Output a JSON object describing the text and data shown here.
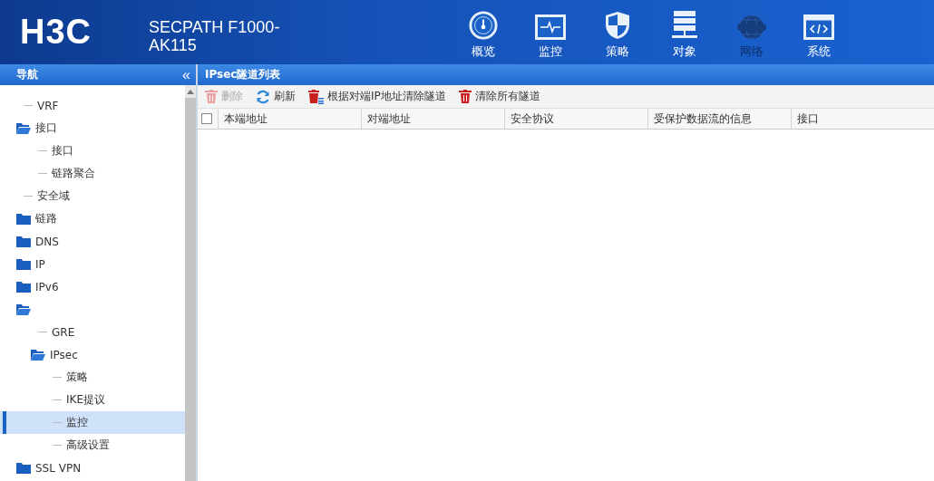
{
  "header": {
    "logo": "H3C",
    "product": "SECPATH F1000-AK115"
  },
  "top_nav": [
    {
      "label": "概览",
      "selected": false
    },
    {
      "label": "监控",
      "selected": false
    },
    {
      "label": "策略",
      "selected": false
    },
    {
      "label": "对象",
      "selected": false
    },
    {
      "label": "网络",
      "selected": true
    },
    {
      "label": "系统",
      "selected": false
    }
  ],
  "sidebar": {
    "title": "导航",
    "collapse": "«",
    "items": [
      {
        "kind": "leaf",
        "label": "VRF",
        "selected": false
      },
      {
        "kind": "folder",
        "label": "接口",
        "expanded": true,
        "selected": false,
        "children": [
          {
            "kind": "leaf",
            "label": "接口",
            "selected": false
          },
          {
            "kind": "leaf",
            "label": "链路聚合",
            "selected": false
          }
        ]
      },
      {
        "kind": "leaf",
        "label": "安全域",
        "selected": false
      },
      {
        "kind": "folder",
        "label": "链路",
        "expanded": false,
        "selected": false
      },
      {
        "kind": "folder",
        "label": "DNS",
        "expanded": false,
        "selected": false
      },
      {
        "kind": "folder",
        "label": "IP",
        "expanded": false,
        "selected": false
      },
      {
        "kind": "folder",
        "label": "IPv6",
        "expanded": false,
        "selected": false
      },
      {
        "kind": "folder",
        "expanded": true,
        "selected": false,
        "children": [
          {
            "kind": "leaf",
            "label": "GRE",
            "selected": false
          },
          {
            "kind": "folder",
            "label": "IPsec",
            "expanded": true,
            "selected": false,
            "children": [
              {
                "kind": "leaf",
                "label": "策略",
                "selected": false
              },
              {
                "kind": "leaf",
                "label": "IKE提议",
                "selected": false
              },
              {
                "kind": "leaf",
                "label": "监控",
                "selected": true
              },
              {
                "kind": "leaf",
                "label": "高级设置",
                "selected": false
              }
            ]
          }
        ]
      },
      {
        "kind": "folder",
        "label": "SSL VPN",
        "expanded": false,
        "selected": false
      }
    ]
  },
  "panel": {
    "title": "IPsec隧道列表",
    "toolbar": [
      {
        "label": "删除",
        "disabled": true
      },
      {
        "label": "刷新",
        "disabled": false
      },
      {
        "label": "根据对端IP地址清除隧道",
        "disabled": false
      },
      {
        "label": "清除所有隧道",
        "disabled": false
      }
    ],
    "table": {
      "select_all_checked": false,
      "columns": [
        "本端地址",
        "对端地址",
        "安全协议",
        "受保护数据流的信息",
        "接口"
      ]
    }
  }
}
